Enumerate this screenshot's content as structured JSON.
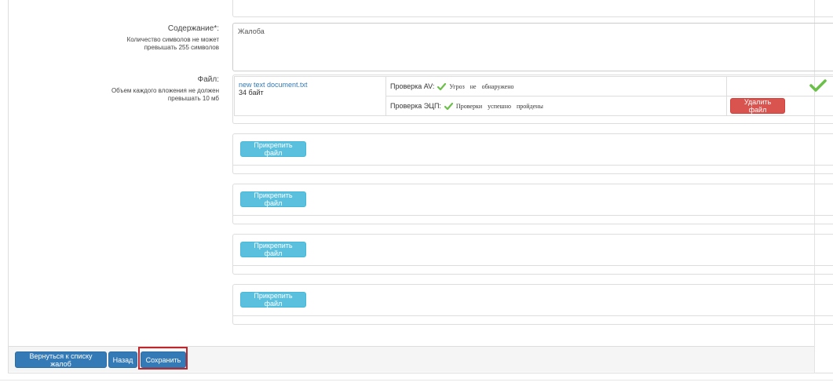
{
  "content_field": {
    "label": "Содержание*:",
    "hint_line1": "Количество символов не может",
    "hint_line2": "превышать 255 символов",
    "value": "Жалоба"
  },
  "file_field": {
    "label": "Файл:",
    "hint_line1": "Объем каждого вложения не должен",
    "hint_line2": "превышать 10 мб",
    "file_name": "new text document.txt",
    "file_size": "34 байт",
    "av_check_label": "Проверка AV:",
    "av_check_status": "Угроз не обнаружено",
    "ecp_check_label": "Проверка ЭЦП:",
    "ecp_check_status": "Проверки успешно пройдены",
    "delete_label": "Удалить файл"
  },
  "attach_slots": [
    {
      "label": "Прикрепить файл"
    },
    {
      "label": "Прикрепить файл"
    },
    {
      "label": "Прикрепить файл"
    },
    {
      "label": "Прикрепить файл"
    }
  ],
  "footer": {
    "back_to_list_label": "Вернуться к списку жалоб",
    "back_label": "Назад",
    "save_label": "Сохранить"
  },
  "colors": {
    "primary": "#337ab7",
    "info": "#5bc0de",
    "danger": "#d9534f",
    "success_check": "#6cc04a",
    "highlight": "#c0272d"
  },
  "icons": {
    "check": "check-icon"
  }
}
